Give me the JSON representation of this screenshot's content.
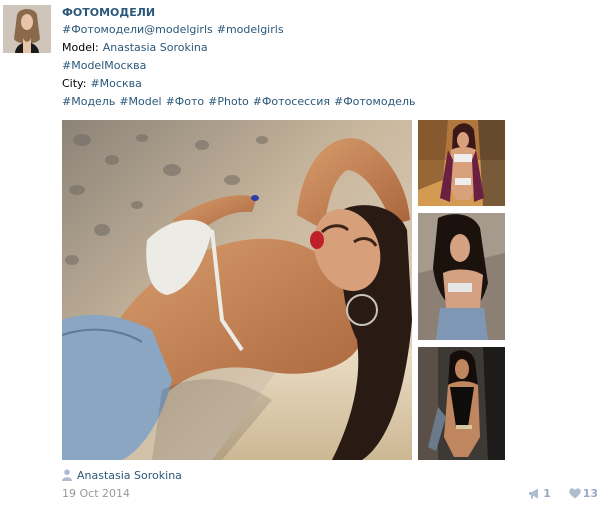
{
  "post": {
    "group_name": "ФОТОМОДЕЛИ",
    "tags_line1": {
      "tag1": "#Фотомодели@modelgirls",
      "tag2": "#modelgirls"
    },
    "model_label": "Model:",
    "model_name": "Anastasia Sorokina",
    "tag_model_moscow": "#ModelМосква",
    "city_label": "City:",
    "city_name": "#Москва",
    "tags_line2": [
      "#Модель",
      "#Model",
      "#Фото",
      "#Photo",
      "#Фотосессия",
      "#Фотомодель"
    ],
    "author_name": "Anastasia Sorokina",
    "date": "19 Oct 2014",
    "reposts": "1",
    "likes": "13"
  },
  "icons": {
    "author": "person-icon",
    "reposts": "megaphone-icon",
    "likes": "heart-icon"
  },
  "colors": {
    "link": "#2b587a",
    "date": "#999999",
    "action": "#96aac3"
  }
}
